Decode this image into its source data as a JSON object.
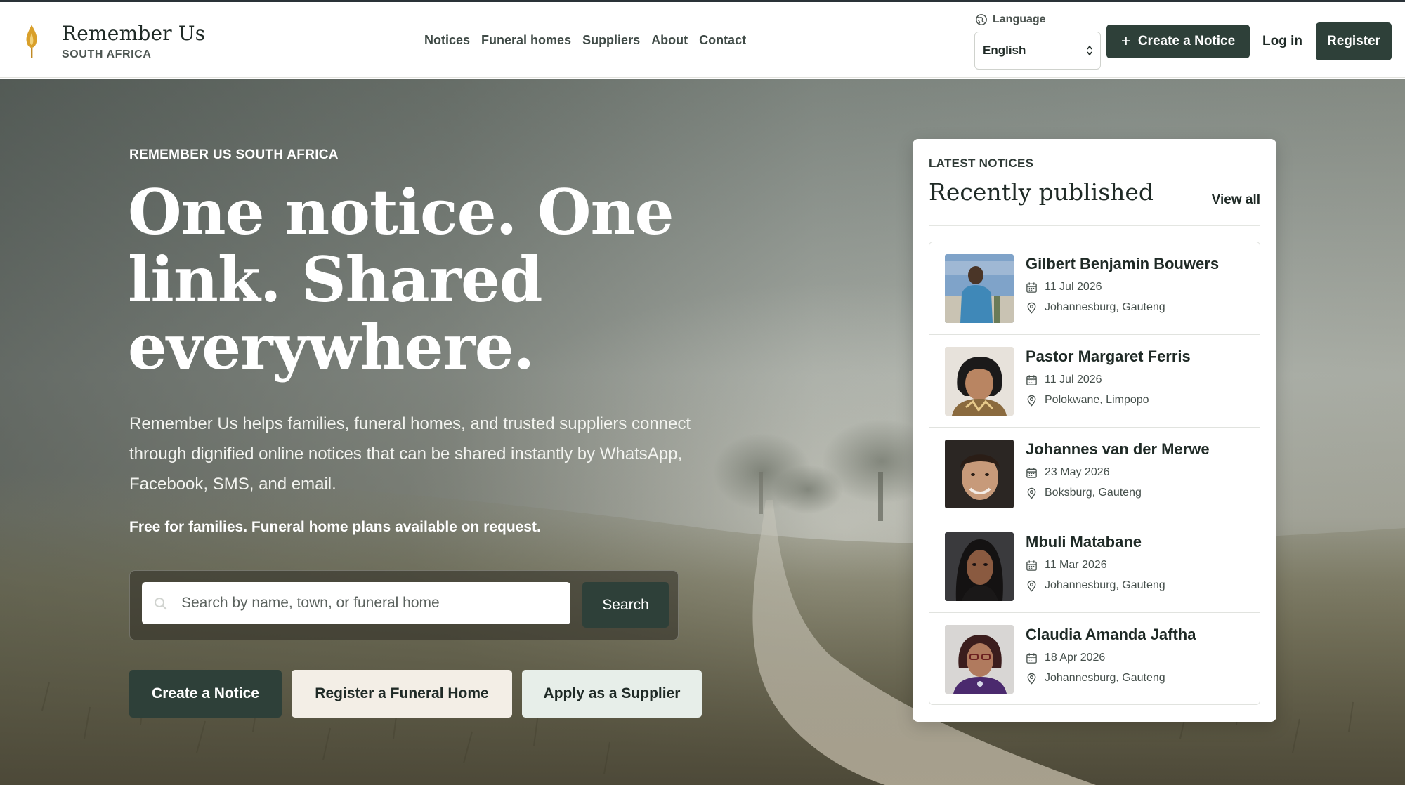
{
  "brand": {
    "name": "Remember Us",
    "subtitle": "SOUTH AFRICA"
  },
  "nav": [
    "Notices",
    "Funeral homes",
    "Suppliers",
    "About",
    "Contact"
  ],
  "language": {
    "label": "Language",
    "selected": "English"
  },
  "header_actions": {
    "create": "Create a Notice",
    "login": "Log in",
    "register": "Register"
  },
  "hero": {
    "eyebrow": "REMEMBER US SOUTH AFRICA",
    "headline": "One notice. One link. Shared everywhere.",
    "lead": "Remember Us helps families, funeral homes, and trusted suppliers connect through dignified online notices that can be shared instantly by WhatsApp, Facebook, SMS, and email.",
    "free_note": "Free for families. Funeral home plans available on request.",
    "search_placeholder": "Search by name, town, or funeral home",
    "search_button": "Search",
    "cta": [
      "Create a Notice",
      "Register a Funeral Home",
      "Apply as a Supplier"
    ]
  },
  "latest": {
    "eyebrow": "LATEST NOTICES",
    "title": "Recently published",
    "view_all": "View all",
    "notices": [
      {
        "name": "Gilbert Benjamin Bouwers",
        "date": "11 Jul 2026",
        "location": "Johannesburg, Gauteng"
      },
      {
        "name": "Pastor Margaret Ferris",
        "date": "11 Jul 2026",
        "location": "Polokwane, Limpopo"
      },
      {
        "name": "Johannes van der Merwe",
        "date": "23 May 2026",
        "location": "Boksburg, Gauteng"
      },
      {
        "name": "Mbuli Matabane",
        "date": "11 Mar 2026",
        "location": "Johannesburg, Gauteng"
      },
      {
        "name": "Claudia Amanda Jaftha",
        "date": "18 Apr 2026",
        "location": "Johannesburg, Gauteng"
      }
    ]
  },
  "colors": {
    "primary": "#2e4039",
    "accent_flame": "#d9a02b",
    "cream_button": "#f3eee6",
    "mint_button": "#e7eee9"
  }
}
